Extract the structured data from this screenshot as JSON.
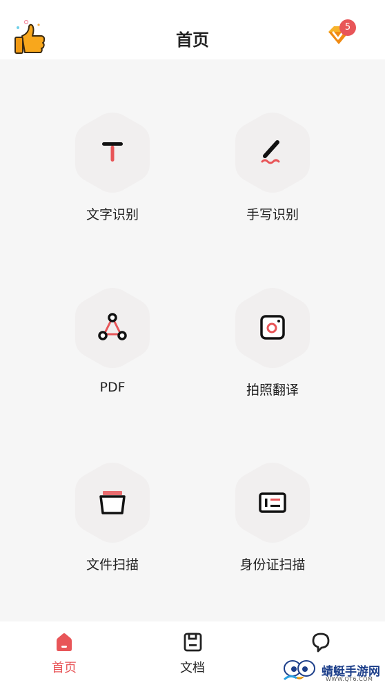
{
  "header": {
    "title": "首页",
    "left_icon": "thumbs-up-icon",
    "right_icon": "vip-diamond-icon",
    "badge_count": "5"
  },
  "tiles": [
    {
      "label": "文字识别",
      "icon": "text-recognition-icon"
    },
    {
      "label": "手写识别",
      "icon": "handwriting-recognition-icon"
    },
    {
      "label": "PDF",
      "icon": "pdf-icon"
    },
    {
      "label": "拍照翻译",
      "icon": "photo-translate-icon"
    },
    {
      "label": "文件扫描",
      "icon": "file-scan-icon"
    },
    {
      "label": "身份证扫描",
      "icon": "id-card-scan-icon"
    }
  ],
  "tabs": [
    {
      "label": "首页",
      "icon": "home-icon",
      "active": true
    },
    {
      "label": "文档",
      "icon": "document-icon",
      "active": false
    },
    {
      "label": "",
      "icon": "chat-bubble-icon",
      "active": false
    }
  ],
  "watermark": {
    "text": "蜻蜓手游网",
    "sub": "WWW.QT6.COM"
  },
  "colors": {
    "accent": "#e85558",
    "background": "#f6f6f6",
    "tile_hex": "#f1efef",
    "text": "#222222"
  }
}
